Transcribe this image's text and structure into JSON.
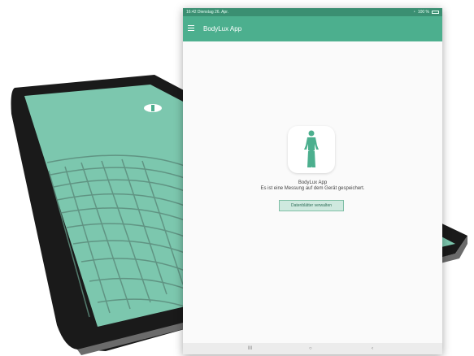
{
  "status_bar": {
    "left": "16:42  Dienstag 26. Apr.",
    "right": "100 %"
  },
  "app_bar": {
    "title": "BodyLux App"
  },
  "content": {
    "app_name": "BodyLux App",
    "measurement_text": "Es ist eine Messung auf dem Gerät gespeichert.",
    "manage_button": "Datenblätter verwalten"
  },
  "nav": {
    "recents": "III",
    "home": "○",
    "back": "‹"
  },
  "colors": {
    "accent": "#4caf8e",
    "status": "#3b8f72",
    "tablet_screen": "#7cc7ae"
  }
}
